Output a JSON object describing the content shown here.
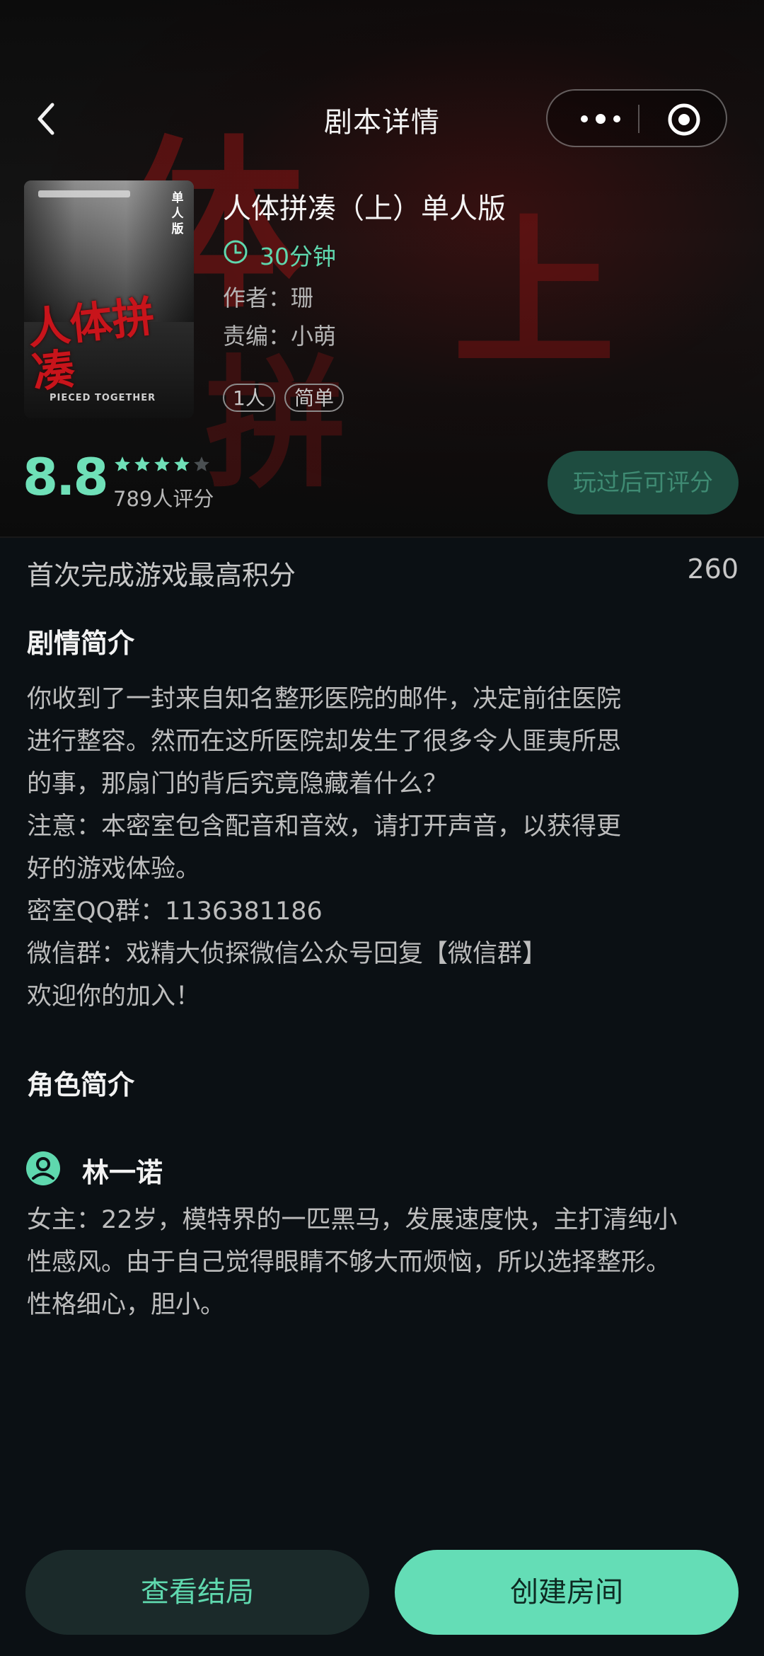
{
  "nav": {
    "title": "剧本详情"
  },
  "game": {
    "cover": {
      "tag": "单人版",
      "title": "人体拼凑",
      "subtitle": "PIECED TOGETHER"
    },
    "title": "人体拼凑（上）单人版",
    "duration": "30分钟",
    "author": "作者：珊",
    "editor": "责编：小萌",
    "chips": [
      "1人",
      "简单"
    ],
    "score": "8.8",
    "stars_filled": 4,
    "stars_total": 5,
    "rating_count": "789人评分",
    "rate_button": "玩过后可评分"
  },
  "record": {
    "label": "首次完成游戏最高积分",
    "value": "260"
  },
  "synopsis": {
    "title": "剧情简介",
    "lines": [
      "你收到了一封来自知名整形医院的邮件，决定前往医院",
      "进行整容。然而在这所医院却发生了很多令人匪夷所思",
      "的事，那扇门的背后究竟隐藏着什么？",
      "注意：本密室包含配音和音效，请打开声音，以获得更",
      "好的游戏体验。",
      "密室QQ群：1136381186",
      "微信群：戏精大侦探微信公众号回复【微信群】",
      "欢迎你的加入！"
    ]
  },
  "roles": {
    "title": "角色简介",
    "items": [
      {
        "name": "林一诺",
        "lines": [
          "女主：22岁，模特界的一匹黑马，发展速度快，主打清纯小",
          "性感风。由于自己觉得眼睛不够大而烦恼，所以选择整形。",
          "性格细心，胆小。"
        ]
      }
    ]
  },
  "buttons": {
    "view_ending": "查看结局",
    "create_room": "创建房间"
  },
  "colors": {
    "accent": "#64ddb6",
    "background": "#0b1014",
    "cover_title": "#c8141b"
  }
}
